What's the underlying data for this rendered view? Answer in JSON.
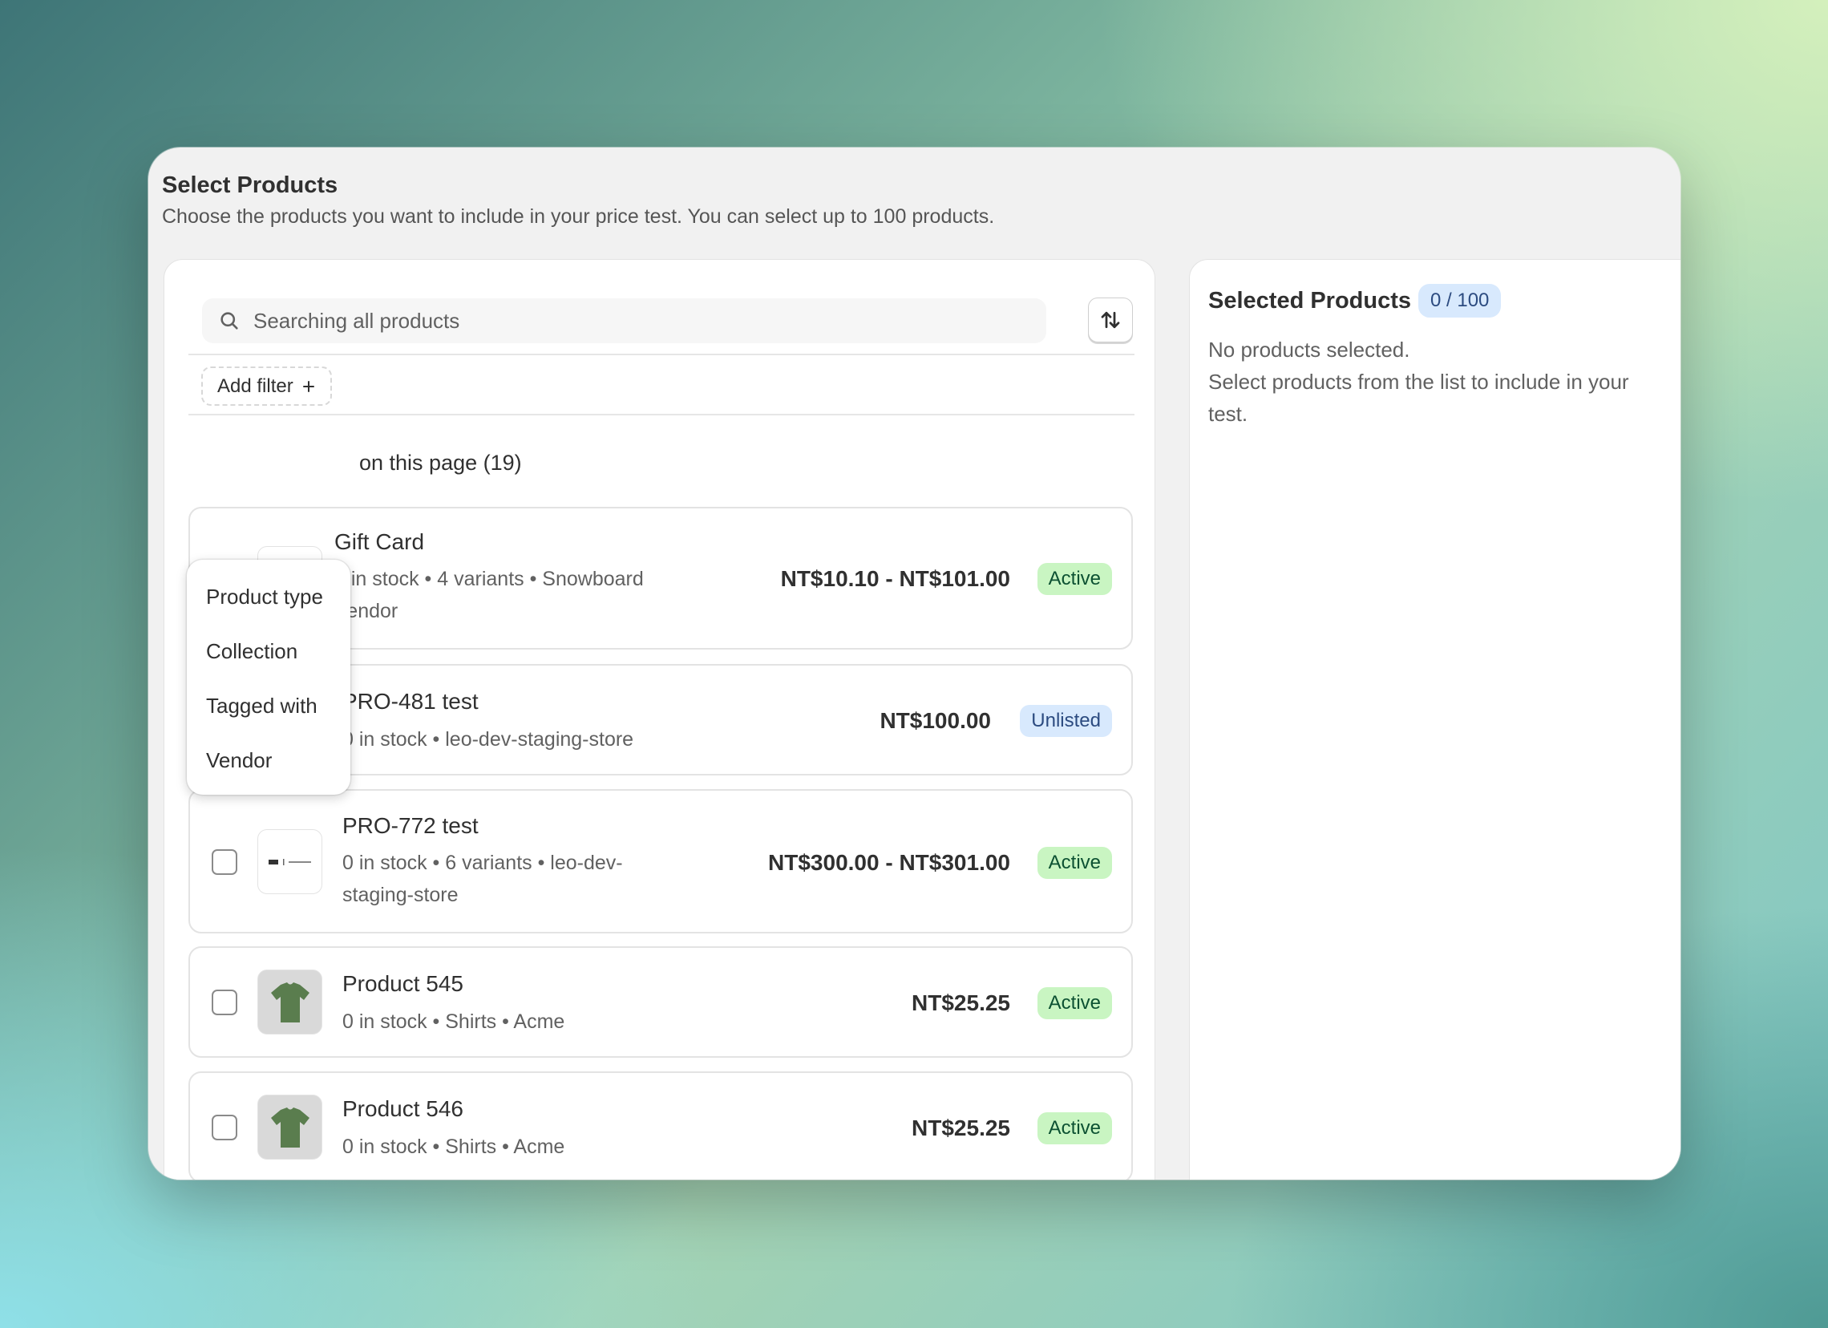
{
  "header": {
    "title": "Select Products",
    "subtitle": "Choose the products you want to include in your price test. You can select up to 100 products."
  },
  "search": {
    "placeholder": "Searching all products"
  },
  "filters": {
    "add_filter_label": "Add filter",
    "options": [
      "Product type",
      "Collection",
      "Tagged with",
      "Vendor"
    ]
  },
  "select_all_label": "on this page (19)",
  "products": [
    {
      "name": "Gift Card",
      "meta_line1": "0 in stock • 4 variants • Snowboard",
      "meta_line2": "Vendor",
      "price": "NT$10.10 - NT$101.00",
      "status": "Active"
    },
    {
      "name": "PRO-481 test",
      "meta_line1": "0 in stock • leo-dev-staging-store",
      "meta_line2": "",
      "price": "NT$100.00",
      "status": "Unlisted"
    },
    {
      "name": "PRO-772 test",
      "meta_line1": "0 in stock • 6 variants • leo-dev-",
      "meta_line2": "staging-store",
      "price": "NT$300.00 - NT$301.00",
      "status": "Active"
    },
    {
      "name": "Product 545",
      "meta_line1": "0 in stock • Shirts • Acme",
      "meta_line2": "",
      "price": "NT$25.25",
      "status": "Active"
    },
    {
      "name": "Product 546",
      "meta_line1": "0 in stock • Shirts • Acme",
      "meta_line2": "",
      "price": "NT$25.25",
      "status": "Active"
    }
  ],
  "selected_panel": {
    "title": "Selected Products",
    "count": "0 / 100",
    "empty_line1": "No products selected.",
    "empty_line2": "Select products from the list to include in your test."
  },
  "colors": {
    "active_badge_bg": "#c9f5c2",
    "unlisted_badge_bg": "#d8e9fd",
    "shirt_green": "#5a7d4e"
  }
}
